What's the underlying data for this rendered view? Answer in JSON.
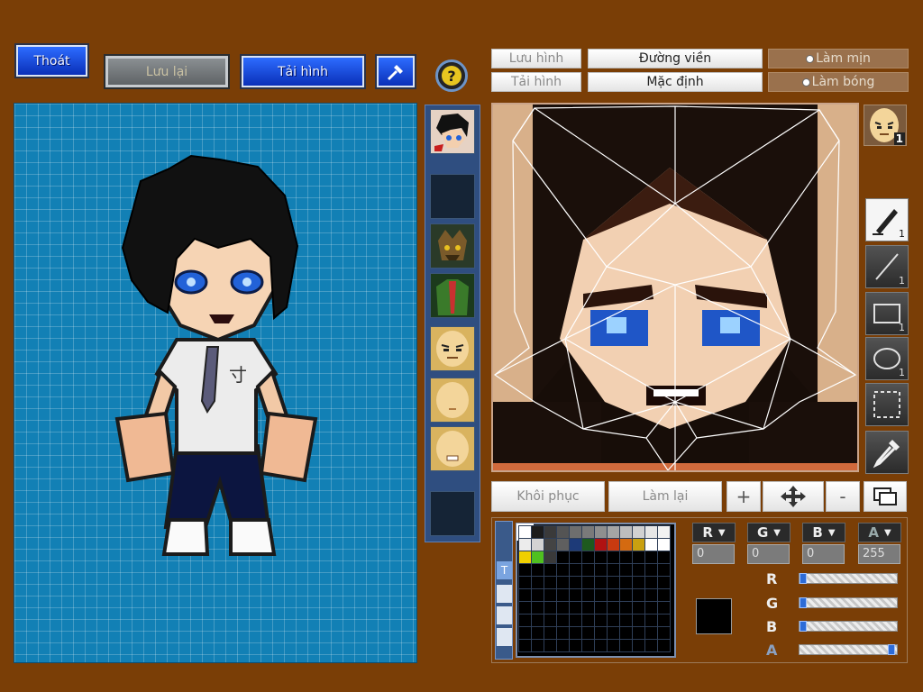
{
  "toolbar": {
    "exit_label": "Thoát",
    "save_label": "Lưu lại",
    "load_label": "Tải hình",
    "hammer_icon": "hammer-icon",
    "help_icon": "help-icon"
  },
  "editor_top": {
    "save_image": "Lưu hình",
    "load_image": "Tải hình",
    "outline": "Đường viền",
    "default": "Mặc định",
    "smooth": "Làm mịn",
    "shade": "Làm bóng"
  },
  "editor_bottom": {
    "restore": "Khôi phục",
    "redo": "Làm lại",
    "zoom_in": "+",
    "zoom_out": "-"
  },
  "color": {
    "r_label": "R",
    "g_label": "G",
    "b_label": "B",
    "a_label": "A",
    "r_value": "0",
    "g_value": "0",
    "b_value": "0",
    "a_value": "255",
    "r_level": 0,
    "g_level": 0,
    "b_level": 0,
    "a_level": 1,
    "current": "#000000"
  },
  "tools": [
    {
      "name": "pen-tool",
      "count": "1"
    },
    {
      "name": "line-tool",
      "count": "1"
    },
    {
      "name": "rectangle-tool",
      "count": "1"
    },
    {
      "name": "ellipse-tool",
      "count": "1"
    },
    {
      "name": "select-tool",
      "count": ""
    },
    {
      "name": "eyedropper-tool",
      "count": ""
    }
  ],
  "avatar_badge_count": "1",
  "palette_tab": "T",
  "palette_row1": [
    "#ffffff",
    "#1c1c1c",
    "#3a3a3a",
    "#545454",
    "#6e6e6e",
    "#7a7a7a",
    "#8f8f8f",
    "#a5a5a5",
    "#bdbdbd",
    "#d1d1d1",
    "#e6e6e6",
    "#f2f2f2"
  ],
  "palette_row2": [
    "#ececec",
    "#d3d3d3",
    "#444444",
    "#5f5f5f",
    "#1d3a78",
    "#1e5a1e",
    "#b01212",
    "#c93a10",
    "#d46a10",
    "#c9a010",
    "#ffffff",
    "#ffffff"
  ],
  "palette_row3": [
    "#f0d000",
    "#50c020",
    "#3a3a3a"
  ]
}
